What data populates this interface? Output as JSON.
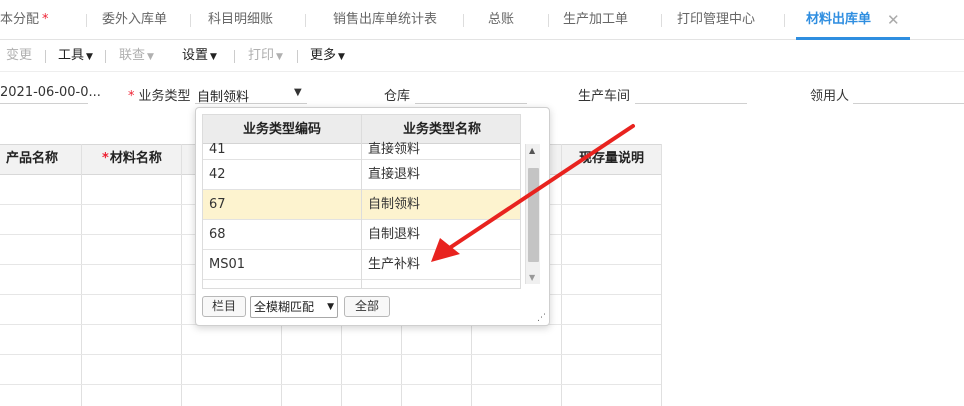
{
  "tabs": [
    {
      "label": "本分配",
      "required": true
    },
    {
      "label": "委外入库单"
    },
    {
      "label": "科目明细账"
    },
    {
      "label": "销售出库单统计表"
    },
    {
      "label": "总账"
    },
    {
      "label": "生产加工单"
    },
    {
      "label": "打印管理中心"
    },
    {
      "label": "材料出库单",
      "active": true
    }
  ],
  "toolbar": {
    "change": "变更",
    "tools": "工具",
    "linked": "联查",
    "settings": "设置",
    "print": "打印",
    "more": "更多"
  },
  "form": {
    "date_value": "2021-06-00-0...",
    "biz_type_label": "业务类型",
    "biz_type_value": "自制领料",
    "warehouse_label": "仓库",
    "workshop_label": "生产车间",
    "receiver_label": "领用人"
  },
  "grid": {
    "headers": [
      "产品名称",
      "材料名称",
      "现存量说明"
    ],
    "required_header": "材料名称"
  },
  "popup": {
    "col_code": "业务类型编码",
    "col_name": "业务类型名称",
    "rows": [
      {
        "code": "41",
        "name": "直接领料"
      },
      {
        "code": "42",
        "name": "直接退料"
      },
      {
        "code": "67",
        "name": "自制领料",
        "selected": true
      },
      {
        "code": "68",
        "name": "自制退料"
      },
      {
        "code": "MS01",
        "name": "生产补料"
      }
    ],
    "columns_button": "栏目",
    "match_mode": "全模糊匹配",
    "all_button": "全部"
  },
  "colors": {
    "accent": "#2f8ee0",
    "required": "#e23333",
    "highlight_row": "#fdf3cf",
    "arrow": "#e8231f"
  }
}
